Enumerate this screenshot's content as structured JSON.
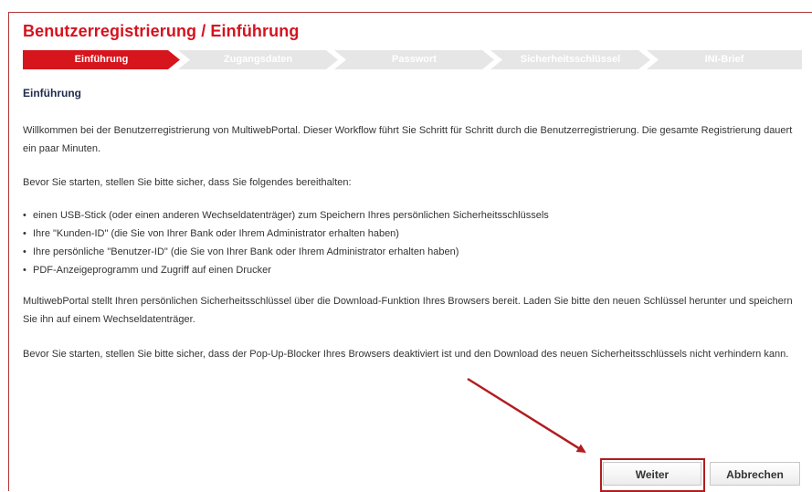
{
  "page": {
    "title": "Benutzerregistrierung / Einführung",
    "steps": [
      {
        "label": "Einführung",
        "active": true
      },
      {
        "label": "Zugangsdaten",
        "active": false
      },
      {
        "label": "Passwort",
        "active": false
      },
      {
        "label": "Sicherheitsschlüssel",
        "active": false
      },
      {
        "label": "INI-Brief",
        "active": false
      }
    ],
    "section_heading": "Einführung",
    "intro": "Willkommen bei der Benutzerregistrierung von MultiwebPortal. Dieser Workflow führt Sie Schritt für Schritt durch die Benutzerregistrierung. Die gesamte Registrierung dauert ein paar Minuten.",
    "prereq_intro": "Bevor Sie starten, stellen Sie bitte sicher, dass Sie folgendes bereithalten:",
    "prereq_items": [
      "einen USB-Stick (oder einen anderen Wechseldatenträger) zum Speichern Ihres persönlichen Sicherheitsschlüssels",
      "Ihre \"Kunden-ID\" (die Sie von Ihrer Bank oder Ihrem Administrator erhalten haben)",
      "Ihre persönliche \"Benutzer-ID\" (die Sie von Ihrer Bank oder Ihrem Administrator erhalten haben)",
      "PDF-Anzeigeprogramm und Zugriff auf einen Drucker"
    ],
    "download_note": "MultiwebPortal stellt Ihren persönlichen Sicherheitsschlüssel über die Download-Funktion Ihres Browsers bereit. Laden Sie bitte den neuen Schlüssel herunter und speichern Sie ihn auf einem Wechseldatenträger.",
    "popup_note": "Bevor Sie starten, stellen Sie bitte sicher, dass der Pop-Up-Blocker Ihres Browsers deaktiviert ist und den Download des neuen Sicherheitsschlüssels nicht verhindern kann."
  },
  "buttons": {
    "next": "Weiter",
    "cancel": "Abbrechen"
  },
  "colors": {
    "accent": "#d6151d",
    "step_inactive": "#e6e6e6",
    "heading": "#1f2b4d",
    "annotation": "#b11d20"
  },
  "bullet": "•"
}
